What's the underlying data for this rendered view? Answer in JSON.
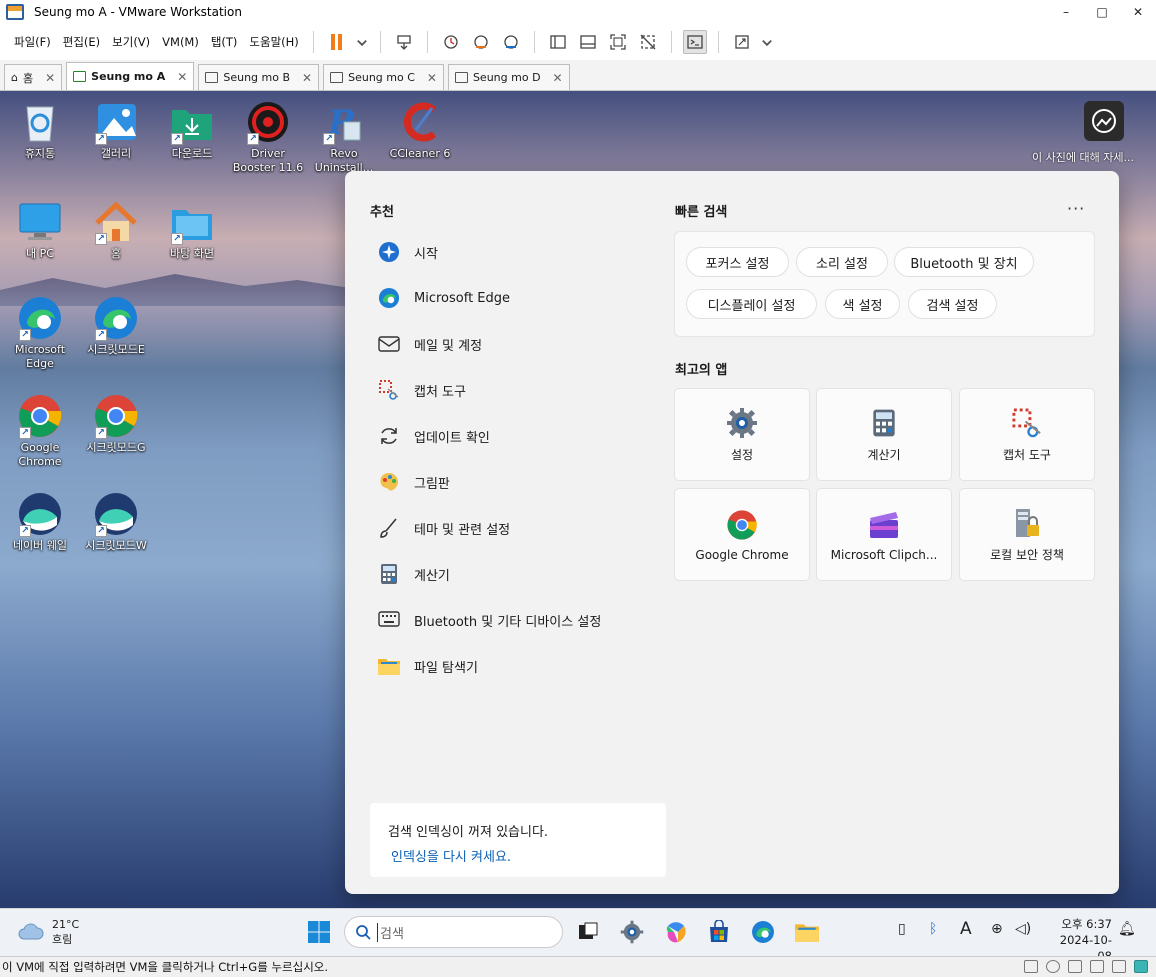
{
  "window": {
    "title": "Seung mo A - VMware Workstation",
    "minimize": "–",
    "maximize": "□",
    "close": "✕"
  },
  "menu": [
    "파일(F)",
    "편집(E)",
    "보기(V)",
    "VM(M)",
    "탭(T)",
    "도움말(H)"
  ],
  "tabs": [
    {
      "label": "홈"
    },
    {
      "label": "Seung mo A"
    },
    {
      "label": "Seung mo B"
    },
    {
      "label": "Seung mo C"
    },
    {
      "label": "Seung mo D"
    }
  ],
  "desktop": {
    "icons": [
      {
        "label": "휴지통"
      },
      {
        "label": "갤러리"
      },
      {
        "label": "다운로드"
      },
      {
        "label": "Driver Booster 11.6"
      },
      {
        "label": "Revo Uninstall..."
      },
      {
        "label": "CCleaner 6"
      },
      {
        "label": "내 PC"
      },
      {
        "label": "홈"
      },
      {
        "label": "바탕 화면"
      },
      {
        "label": "Microsoft Edge"
      },
      {
        "label": "시크릿모드E"
      },
      {
        "label": "Google Chrome"
      },
      {
        "label": "시크릿모드G"
      },
      {
        "label": "네이버 웨일"
      },
      {
        "label": "시크릿모드W"
      }
    ],
    "photo_label": "이 사진에 대해 자세..."
  },
  "search_panel": {
    "recommended_title": "추천",
    "recommended": [
      {
        "label": "시작"
      },
      {
        "label": "Microsoft Edge"
      },
      {
        "label": "메일 및 계정"
      },
      {
        "label": "캡처 도구"
      },
      {
        "label": "업데이트 확인"
      },
      {
        "label": "그림판"
      },
      {
        "label": "테마 및 관련 설정"
      },
      {
        "label": "계산기"
      },
      {
        "label": "Bluetooth 및 기타 디바이스 설정"
      },
      {
        "label": "파일 탐색기"
      }
    ],
    "quick_title": "빠른 검색",
    "more": "···",
    "quick": [
      {
        "label": "포커스 설정"
      },
      {
        "label": "소리 설정"
      },
      {
        "label": "Bluetooth 및 장치"
      },
      {
        "label": "디스플레이 설정"
      },
      {
        "label": "색 설정"
      },
      {
        "label": "검색 설정"
      }
    ],
    "top_apps_title": "최고의 앱",
    "top_apps": [
      {
        "label": "설정"
      },
      {
        "label": "계산기"
      },
      {
        "label": "캡처 도구"
      },
      {
        "label": "Google Chrome"
      },
      {
        "label": "Microsoft Clipch..."
      },
      {
        "label": "로컬 보안 정책"
      }
    ],
    "index_notice": "검색 인덱싱이 꺼져 있습니다.",
    "index_link": "인덱싱을 다시 켜세요."
  },
  "taskbar": {
    "weather_temp": "21°C",
    "weather_cond": "흐림",
    "search_placeholder": "검색",
    "time": "오후 6:37",
    "date": "2024-10-08"
  },
  "statusbar": {
    "text": "이 VM에 직접 입력하려면 VM을 클릭하거나 Ctrl+G를 누르십시오."
  },
  "colors": {
    "accent": "#0a5fb4",
    "pause": "#f07d1a",
    "link": "#0a5fb4"
  }
}
